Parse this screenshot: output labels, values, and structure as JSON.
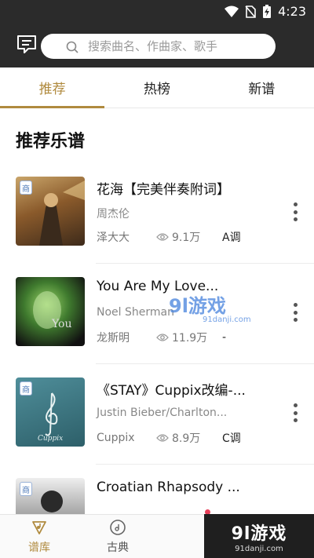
{
  "status": {
    "time": "4:23"
  },
  "search": {
    "placeholder": "搜索曲名、作曲家、歌手"
  },
  "tabs": [
    {
      "label": "推荐"
    },
    {
      "label": "热榜"
    },
    {
      "label": "新谱"
    }
  ],
  "section": {
    "title": "推荐乐谱"
  },
  "items": [
    {
      "badge": "商",
      "title": "花海【完美伴奏附词】",
      "artist": "周杰伦",
      "uploader": "泽大大",
      "views": "9.1万",
      "key": "A调"
    },
    {
      "badge": "",
      "title": "You Are My Love...",
      "artist": "Noel Sherman",
      "uploader": "龙斯明",
      "views": "11.9万",
      "key": "-"
    },
    {
      "badge": "商",
      "title": "《STAY》Cuppix改编-...",
      "artist": "Justin Bieber/Charlton...",
      "uploader": "Cuppix",
      "views": "8.9万",
      "key": "C调"
    },
    {
      "badge": "商",
      "title": "Croatian Rhapsody ...",
      "artist": "",
      "uploader": "",
      "views": "",
      "key": ""
    }
  ],
  "bottom_nav": [
    {
      "label": "谱库"
    },
    {
      "label": "古典"
    }
  ],
  "watermark": {
    "logo": "9l游戏",
    "url": "91danji.com"
  },
  "overlay": {
    "logo": "9l游戏",
    "url": "91danji.com"
  },
  "colors": {
    "accent": "#b08a3e",
    "topbar": "#2b2b2b"
  }
}
